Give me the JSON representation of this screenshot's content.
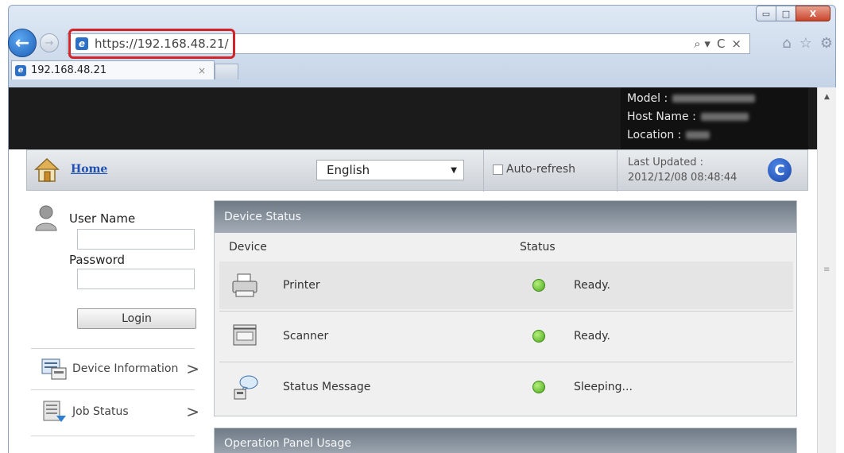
{
  "browser": {
    "url": "https://192.168.48.21/",
    "tab_title": "192.168.48.21",
    "tab_close": "×",
    "back_glyph": "←",
    "forward_glyph": "→",
    "addr_tools": {
      "search": "⌕ ▾",
      "refresh": "C",
      "stop": "×"
    },
    "icons": {
      "home": "⌂",
      "favorites": "☆",
      "settings": "⚙"
    },
    "window_controls": {
      "minimize": "▭",
      "maximize": "□",
      "close": "X"
    }
  },
  "device_meta": {
    "model_label": "Model :",
    "host_label": "Host Name :",
    "location_label": "Location :"
  },
  "header": {
    "home_link": "Home",
    "language": "English",
    "auto_refresh_label": "Auto-refresh",
    "last_updated_label": "Last Updated :",
    "last_updated_value": "2012/12/08 08:48:44",
    "refresh_glyph": "C"
  },
  "login": {
    "username_label": "User Name",
    "password_label": "Password",
    "login_button": "Login"
  },
  "sidebar": {
    "items": [
      {
        "label": "Device Information",
        "chevron": ">"
      },
      {
        "label": "Job Status",
        "chevron": ">"
      }
    ]
  },
  "device_status": {
    "title": "Device Status",
    "col_device": "Device",
    "col_status": "Status",
    "rows": [
      {
        "device": "Printer",
        "status": "Ready.",
        "icon": "printer-icon"
      },
      {
        "device": "Scanner",
        "status": "Ready.",
        "icon": "scanner-icon"
      },
      {
        "device": "Status Message",
        "status": "Sleeping...",
        "icon": "status-message-icon"
      }
    ],
    "status_color": "#4aa81e"
  },
  "operation_panel": {
    "title": "Operation Panel Usage"
  },
  "colors": {
    "accent_link": "#1e4fb3",
    "highlight_box": "#d0252b",
    "panel_header": "#6f7a86",
    "banner": "#1b1b1b"
  }
}
